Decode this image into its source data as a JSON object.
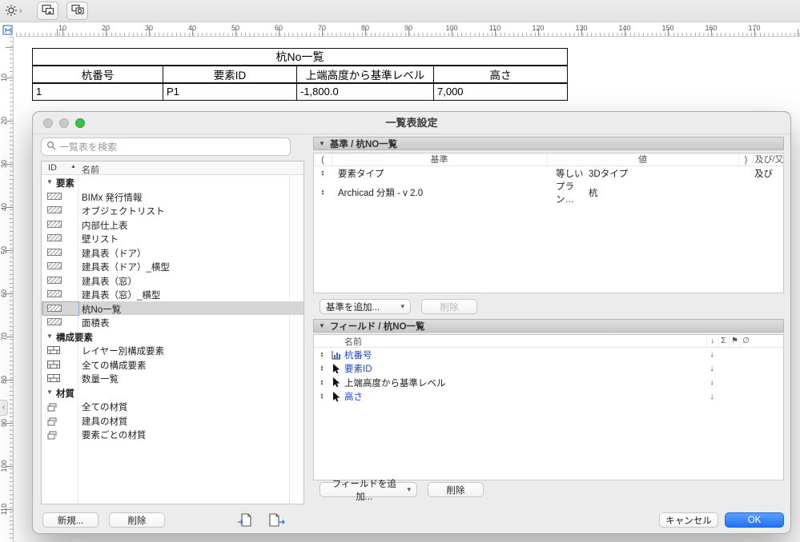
{
  "colors": {
    "ok_blue": "#2f7ef6",
    "link_blue": "#2245cc",
    "selection_gray": "#d5d5d5",
    "green_dot": "#3ac24b"
  },
  "rulers": {
    "h_numbers": [
      10,
      20,
      30,
      40,
      50,
      60,
      70,
      80,
      90,
      100,
      110,
      120,
      130,
      140,
      150,
      160,
      170
    ],
    "v_numbers": [
      10,
      20,
      30,
      40,
      50,
      60,
      70,
      80,
      90,
      100,
      110
    ]
  },
  "document": {
    "table": {
      "title": "杭No一覧",
      "headers": [
        "杭番号",
        "要素ID",
        "上端高度から基準レベル",
        "高さ"
      ],
      "rows": [
        [
          "1",
          "P1",
          "-1,800.0",
          "7,000"
        ]
      ]
    }
  },
  "dialog": {
    "title": "一覧表設定",
    "search": {
      "placeholder": "一覧表を検索"
    },
    "list": {
      "columns": {
        "id": "ID",
        "name": "名前",
        "sort": "▲"
      },
      "groups": [
        {
          "label": "要素",
          "items": [
            {
              "name": "BIMx 発行情報",
              "icon": "schedule-icon",
              "selected": false
            },
            {
              "name": "オブジェクトリスト",
              "icon": "schedule-icon",
              "selected": false
            },
            {
              "name": "内部仕上表",
              "icon": "schedule-icon",
              "selected": false
            },
            {
              "name": "壁リスト",
              "icon": "schedule-icon",
              "selected": false
            },
            {
              "name": "建具表（ドア）",
              "icon": "schedule-icon",
              "selected": false
            },
            {
              "name": "建具表（ドア）_横型",
              "icon": "schedule-icon",
              "selected": false
            },
            {
              "name": "建具表（窓）",
              "icon": "schedule-icon",
              "selected": false
            },
            {
              "name": "建具表（窓）_横型",
              "icon": "schedule-icon",
              "selected": false
            },
            {
              "name": "杭No一覧",
              "icon": "schedule-icon",
              "selected": true
            },
            {
              "name": "面積表",
              "icon": "schedule-icon",
              "selected": false
            }
          ]
        },
        {
          "label": "構成要素",
          "items": [
            {
              "name": "レイヤー別構成要素",
              "icon": "composite-icon",
              "selected": false
            },
            {
              "name": "全ての構成要素",
              "icon": "composite-icon",
              "selected": false
            },
            {
              "name": "数量一覧",
              "icon": "composite-icon",
              "selected": false
            }
          ]
        },
        {
          "label": "材質",
          "items": [
            {
              "name": "全ての材質",
              "icon": "material-icon",
              "selected": false
            },
            {
              "name": "建具の材質",
              "icon": "material-icon",
              "selected": false
            },
            {
              "name": "要素ごとの材質",
              "icon": "material-icon",
              "selected": false
            }
          ]
        }
      ],
      "buttons": {
        "new": "新規...",
        "delete": "削除"
      }
    },
    "criteria": {
      "header": "基準 / 杭NO一覧",
      "columns": [
        "(",
        "基準",
        "値",
        ")",
        "及び/又は"
      ],
      "rows": [
        {
          "criterion": "要素タイプ",
          "operator": "等しい",
          "value": "3Dタイプ",
          "logic": "及び"
        },
        {
          "criterion": "Archicad 分類 - v 2.0",
          "operator": "プラン…",
          "value": "杭",
          "logic": ""
        }
      ],
      "add_button": "基準を追加...",
      "delete_button": "削除"
    },
    "fields": {
      "header": "フィールド / 杭NO一覧",
      "name_column": "名前",
      "icon_columns": [
        "↓",
        "Σ",
        "⚑",
        "∅"
      ],
      "sort_indicator": "↓",
      "rows": [
        {
          "name": "杭番号",
          "icon": "chart-icon",
          "link": true
        },
        {
          "name": "要素ID",
          "icon": "cursor-icon",
          "link": true
        },
        {
          "name": "上端高度から基準レベル",
          "icon": "cursor-icon",
          "link": false
        },
        {
          "name": "高さ",
          "icon": "cursor-icon",
          "link": true
        }
      ],
      "add_button": "フィールドを追加...",
      "delete_button": "削除"
    },
    "footer": {
      "cancel": "キャンセル",
      "ok": "OK"
    }
  }
}
